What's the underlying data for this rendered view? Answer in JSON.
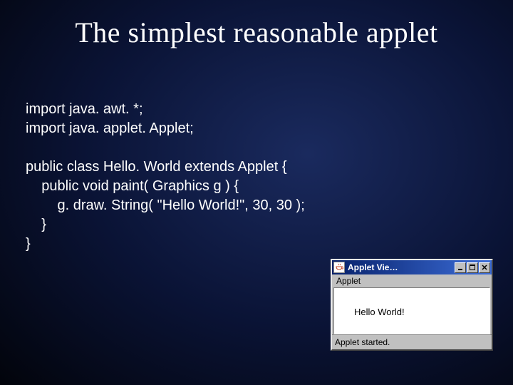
{
  "title": "The simplest reasonable applet",
  "code": {
    "line1": "import java. awt. *;",
    "line2": "import java. applet. Applet;",
    "line3": "public class Hello. World extends Applet {",
    "line4": "    public void paint( Graphics g ) {",
    "line5": "        g. draw. String( \"Hello World!\", 30, 30 );",
    "line6": "    }",
    "line7": "}"
  },
  "applet_window": {
    "title": "Applet Vie…",
    "menu": "Applet",
    "canvas_text": "Hello World!",
    "status": "Applet started."
  }
}
